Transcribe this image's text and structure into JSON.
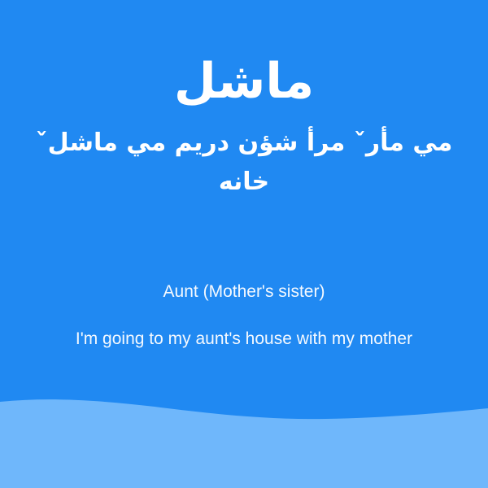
{
  "card": {
    "headword": "ماشل",
    "sentence_native": "مي مأرˇ مرأ شؤن دريم مي ماشلˇ خانه",
    "meaning": "Aunt (Mother's sister)",
    "translation": "I'm going to my aunt's house with my mother"
  },
  "colors": {
    "background": "#2089f2",
    "wave": "#6fb7fb",
    "text": "#ffffff"
  }
}
